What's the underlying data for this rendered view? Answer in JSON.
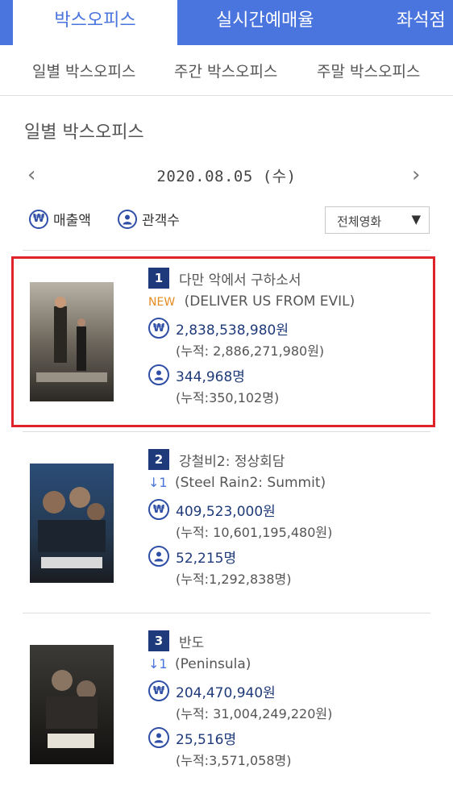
{
  "top_tabs": [
    {
      "label": "박스오피스",
      "active": true
    },
    {
      "label": "실시간예매율"
    },
    {
      "label": "좌석점"
    }
  ],
  "sub_tabs": [
    "일별 박스오피스",
    "주간 박스오피스",
    "주말 박스오피스"
  ],
  "section_title": "일별 박스오피스",
  "date": "2020.08.05 (수)",
  "toggles": {
    "sales": "매출액",
    "audience": "관객수"
  },
  "filter": {
    "selected": "전체영화"
  },
  "colors": {
    "accent": "#4a74de",
    "rank_badge": "#1f3a7a",
    "new": "#e58b22",
    "highlight": "#e0222b"
  },
  "movies": [
    {
      "rank": "1",
      "title_ko": "다만 악에서 구하소서",
      "badge": "NEW",
      "rank_change": "",
      "title_en": "(DELIVER US FROM EVIL)",
      "sales": "2,838,538,980원",
      "sales_total": "(누적: 2,886,271,980원)",
      "audience": "344,968명",
      "audience_total": "(누적:350,102명)"
    },
    {
      "rank": "2",
      "title_ko": "강철비2: 정상회담",
      "badge": "",
      "rank_change": "↓1",
      "title_en": "(Steel Rain2: Summit)",
      "sales": "409,523,000원",
      "sales_total": "(누적: 10,601,195,480원)",
      "audience": "52,215명",
      "audience_total": "(누적:1,292,838명)"
    },
    {
      "rank": "3",
      "title_ko": "반도",
      "badge": "",
      "rank_change": "↓1",
      "title_en": "(Peninsula)",
      "sales": "204,470,940원",
      "sales_total": "(누적: 31,004,249,220원)",
      "audience": "25,516명",
      "audience_total": "(누적:3,571,058명)"
    }
  ]
}
